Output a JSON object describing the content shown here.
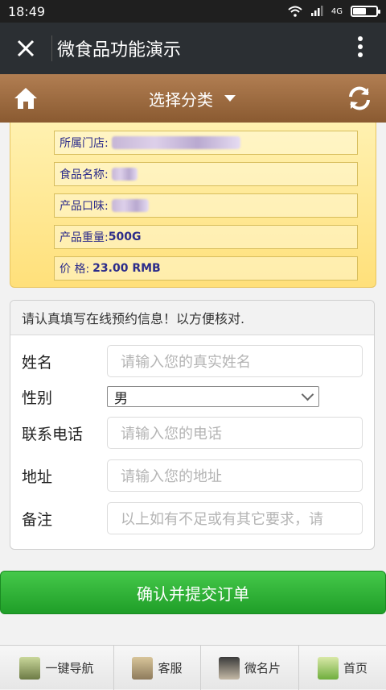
{
  "status": {
    "time": "18:49",
    "network": "4G"
  },
  "app": {
    "title": "微食品功能演示"
  },
  "category": {
    "label": "选择分类"
  },
  "product": {
    "store_label": "所属门店:",
    "name_label": "食品名称:",
    "flavor_label": "产品口味:",
    "weight_label": "产品重量:",
    "weight_value": "500G",
    "price_label": "价 格:",
    "price_value": "23.00 RMB"
  },
  "form": {
    "heading": "请认真填写在线预约信息！以方便核对.",
    "name_label": "姓名",
    "name_placeholder": "请输入您的真实姓名",
    "gender_label": "性别",
    "gender_value": "男",
    "phone_label": "联系电话",
    "phone_placeholder": "请输入您的电话",
    "address_label": "地址",
    "address_placeholder": "请输入您的地址",
    "note_label": "备注",
    "note_placeholder": "以上如有不足或有其它要求，请"
  },
  "submit_label": "确认并提交订单",
  "nav": {
    "items": [
      {
        "label": "一键导航"
      },
      {
        "label": "客服"
      },
      {
        "label": "微名片"
      },
      {
        "label": "首页"
      }
    ]
  },
  "colors": {
    "brand_green": "#2fb236",
    "bar_brown": "#9c6b3f",
    "label_blue": "#2c2c8a"
  }
}
